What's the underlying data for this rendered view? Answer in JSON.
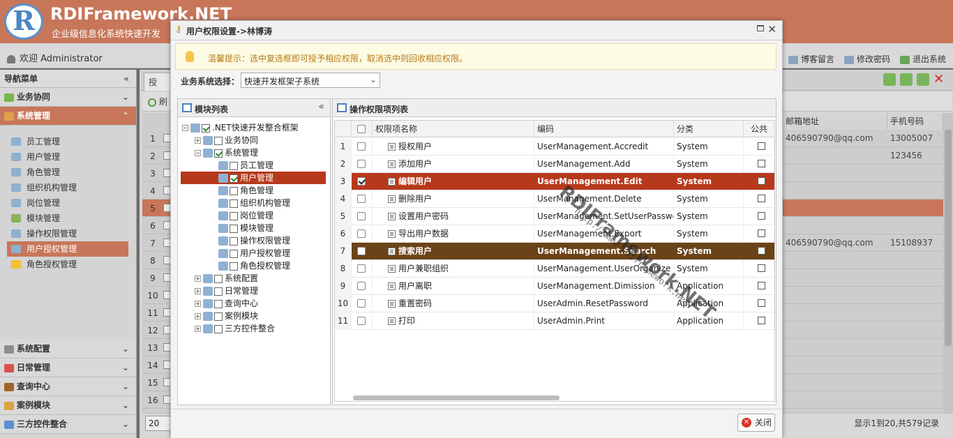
{
  "app": {
    "logo_letter": "R",
    "brand": "RDIFramework.NET",
    "brand_sub": "企业级信息化系统快速开发",
    "welcome": "欢迎 Administrator",
    "top_links": [
      "博客留言",
      "修改密码",
      "退出系统"
    ]
  },
  "nav": {
    "header": "导航菜单",
    "sections_top": [
      {
        "label": "业务协同",
        "active": false
      },
      {
        "label": "系统管理",
        "active": true
      }
    ],
    "items": [
      "员工管理",
      "用户管理",
      "角色管理",
      "组织机构管理",
      "岗位管理",
      "模块管理",
      "操作权限管理",
      "用户授权管理",
      "角色授权管理"
    ],
    "selected_item": "用户授权管理",
    "sections_bottom": [
      "系统配置",
      "日常管理",
      "查询中心",
      "案例模块",
      "三方控件整合"
    ]
  },
  "bg": {
    "tab": "授",
    "toolbar_label": "刷",
    "row_numbers": [
      "1",
      "2",
      "3",
      "4",
      "5",
      "6",
      "7",
      "8",
      "9",
      "10",
      "11",
      "12",
      "13",
      "14",
      "15",
      "16"
    ],
    "col_email": "邮箱地址",
    "col_mobile": "手机号码",
    "email_row1": "406590790@qq.com",
    "mobile_row1": "13005007",
    "mobile_row2": "123456",
    "email_row7": "406590790@qq.com",
    "mobile_row7": "15108937",
    "page_size": "20",
    "page_info": "显示1到20,共579记录"
  },
  "modal": {
    "title": "用户权限设置->林博涛",
    "tip": "温馨提示：选中复选框即可授予相应权限，取消选中则回收相应权限。",
    "system_label": "业务系统选择：",
    "system_value": "快速开发框架子系统",
    "module_panel_title": "模块列表",
    "op_panel_title": "操作权限项列表",
    "close_label": "关闭",
    "watermark": "RDIFramework.NET",
    "watermark_url": "http://www.rdiframework.net/"
  },
  "tree": [
    {
      "label": ".NET快速开发整合框架",
      "level": 0,
      "checked": true,
      "exp": "−"
    },
    {
      "label": "业务协同",
      "level": 1,
      "checked": false,
      "exp": "+"
    },
    {
      "label": "系统管理",
      "level": 1,
      "checked": true,
      "exp": "−"
    },
    {
      "label": "员工管理",
      "level": 2,
      "checked": false
    },
    {
      "label": "用户管理",
      "level": 2,
      "checked": true,
      "selected": true
    },
    {
      "label": "角色管理",
      "level": 2,
      "checked": false
    },
    {
      "label": "组织机构管理",
      "level": 2,
      "checked": false
    },
    {
      "label": "岗位管理",
      "level": 2,
      "checked": false
    },
    {
      "label": "模块管理",
      "level": 2,
      "checked": false
    },
    {
      "label": "操作权限管理",
      "level": 2,
      "checked": false
    },
    {
      "label": "用户授权管理",
      "level": 2,
      "checked": false
    },
    {
      "label": "角色授权管理",
      "level": 2,
      "checked": false
    },
    {
      "label": "系统配置",
      "level": 1,
      "checked": false,
      "exp": "+"
    },
    {
      "label": "日常管理",
      "level": 1,
      "checked": false,
      "exp": "+"
    },
    {
      "label": "查询中心",
      "level": 1,
      "checked": false,
      "exp": "+"
    },
    {
      "label": "案例模块",
      "level": 1,
      "checked": false,
      "exp": "+"
    },
    {
      "label": "三方控件整合",
      "level": 1,
      "checked": false,
      "exp": "+"
    }
  ],
  "grid": {
    "columns": [
      "权限项名称",
      "编码",
      "分类",
      "公共"
    ],
    "rows": [
      {
        "num": "1",
        "name": "授权用户",
        "code": "UserManagement.Accredit",
        "category": "System",
        "checked": false
      },
      {
        "num": "2",
        "name": "添加用户",
        "code": "UserManagement.Add",
        "category": "System",
        "checked": false
      },
      {
        "num": "3",
        "name": "编辑用户",
        "code": "UserManagement.Edit",
        "category": "System",
        "checked": true,
        "highlight": "red"
      },
      {
        "num": "4",
        "name": "删除用户",
        "code": "UserManagement.Delete",
        "category": "System",
        "checked": false
      },
      {
        "num": "5",
        "name": "设置用户密码",
        "code": "UserManagement.SetUserPasswo",
        "category": "System",
        "checked": false
      },
      {
        "num": "6",
        "name": "导出用户数据",
        "code": "UserManagement.Export",
        "category": "System",
        "checked": false
      },
      {
        "num": "7",
        "name": "搜索用户",
        "code": "UserManagement.Search",
        "category": "System",
        "checked": false,
        "highlight": "brown"
      },
      {
        "num": "8",
        "name": "用户兼职组织",
        "code": "UserManagement.UserOrganize",
        "category": "System",
        "checked": false
      },
      {
        "num": "9",
        "name": "用户离职",
        "code": "UserManagement.Dimission",
        "category": "Application",
        "checked": false
      },
      {
        "num": "10",
        "name": "重置密码",
        "code": "UserAdmin.ResetPassword",
        "category": "Application",
        "checked": false
      },
      {
        "num": "11",
        "name": "打印",
        "code": "UserAdmin.Print",
        "category": "Application",
        "checked": false
      }
    ]
  },
  "colors": {
    "brand": "#c8765a",
    "row_selected": "#b7391c",
    "row_hover": "#6b4318"
  }
}
